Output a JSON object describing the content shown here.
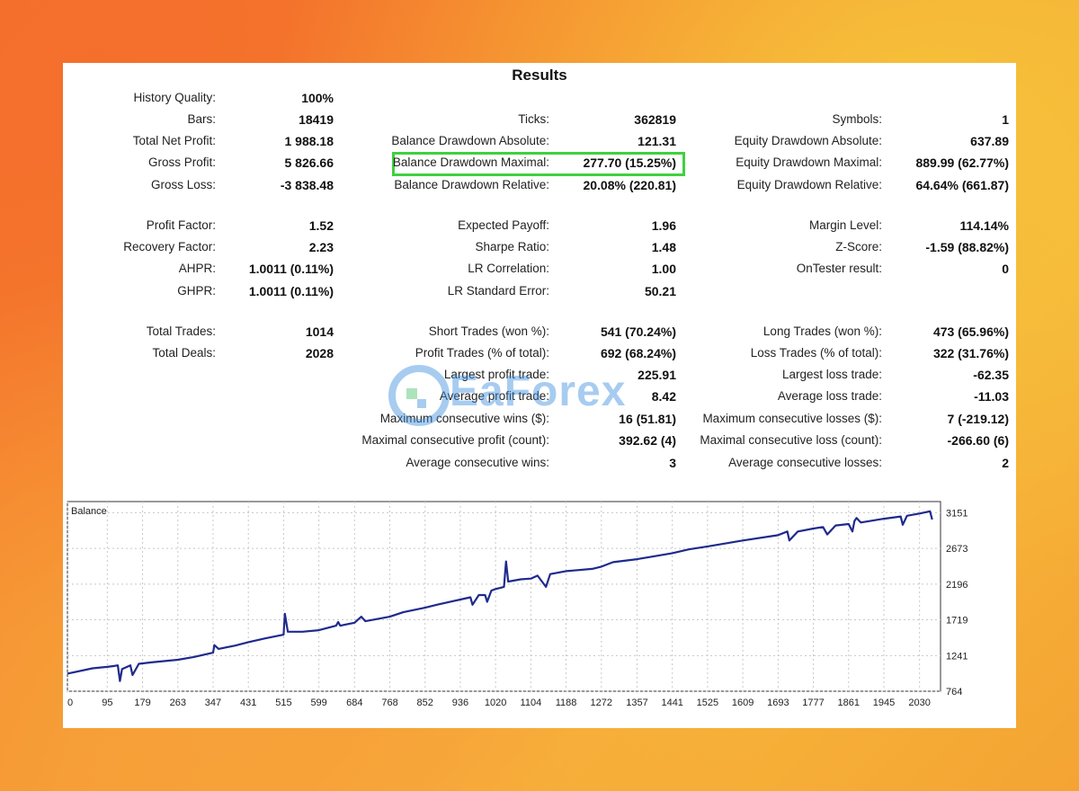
{
  "title": "Results",
  "watermark": "EaForex",
  "col1": [
    {
      "label": "History Quality:",
      "value": "100%"
    },
    {
      "label": "Bars:",
      "value": "18419"
    },
    {
      "label": "Total Net Profit:",
      "value": "1 988.18"
    },
    {
      "label": "Gross Profit:",
      "value": "5 826.66"
    },
    {
      "label": "Gross Loss:",
      "value": "-3 838.48"
    },
    {
      "label": "Profit Factor:",
      "value": "1.52"
    },
    {
      "label": "Recovery Factor:",
      "value": "2.23"
    },
    {
      "label": "AHPR:",
      "value": "1.0011 (0.11%)"
    },
    {
      "label": "GHPR:",
      "value": "1.0011 (0.11%)"
    },
    {
      "label": "Total Trades:",
      "value": "1014"
    },
    {
      "label": "Total Deals:",
      "value": "2028"
    }
  ],
  "col2": [
    {
      "label": "Ticks:",
      "value": "362819"
    },
    {
      "label": "Balance Drawdown Absolute:",
      "value": "121.31"
    },
    {
      "label": "Balance Drawdown Maximal:",
      "value": "277.70 (15.25%)"
    },
    {
      "label": "Balance Drawdown Relative:",
      "value": "20.08% (220.81)"
    },
    {
      "label": "Expected Payoff:",
      "value": "1.96"
    },
    {
      "label": "Sharpe Ratio:",
      "value": "1.48"
    },
    {
      "label": "LR Correlation:",
      "value": "1.00"
    },
    {
      "label": "LR Standard Error:",
      "value": "50.21"
    },
    {
      "label": "Short Trades (won %):",
      "value": "541 (70.24%)"
    },
    {
      "label": "Profit Trades (% of total):",
      "value": "692 (68.24%)"
    },
    {
      "label": "Largest profit trade:",
      "value": "225.91"
    },
    {
      "label": "Average profit trade:",
      "value": "8.42"
    },
    {
      "label": "Maximum consecutive wins ($):",
      "value": "16 (51.81)"
    },
    {
      "label": "Maximal consecutive profit (count):",
      "value": "392.62 (4)"
    },
    {
      "label": "Average consecutive wins:",
      "value": "3"
    }
  ],
  "col3": [
    {
      "label": "Symbols:",
      "value": "1"
    },
    {
      "label": "Equity Drawdown Absolute:",
      "value": "637.89"
    },
    {
      "label": "Equity Drawdown Maximal:",
      "value": "889.99 (62.77%)"
    },
    {
      "label": "Equity Drawdown Relative:",
      "value": "64.64% (661.87)"
    },
    {
      "label": "Margin Level:",
      "value": "114.14%"
    },
    {
      "label": "Z-Score:",
      "value": "-1.59 (88.82%)"
    },
    {
      "label": "OnTester result:",
      "value": "0"
    },
    {
      "label": "Long Trades (won %):",
      "value": "473 (65.96%)"
    },
    {
      "label": "Loss Trades (% of total):",
      "value": "322 (31.76%)"
    },
    {
      "label": "Largest loss trade:",
      "value": "-62.35"
    },
    {
      "label": "Average loss trade:",
      "value": "-11.03"
    },
    {
      "label": "Maximum consecutive losses ($):",
      "value": "7 (-219.12)"
    },
    {
      "label": "Maximal consecutive loss (count):",
      "value": "-266.60 (6)"
    },
    {
      "label": "Average consecutive losses:",
      "value": "2"
    }
  ],
  "highlight_color": "#3fd13f",
  "chart_data": {
    "type": "line",
    "title": "Balance",
    "series": [
      {
        "color": "#1f2a8c",
        "points": [
          [
            0,
            1000
          ],
          [
            60,
            1070
          ],
          [
            95,
            1090
          ],
          [
            110,
            1100
          ],
          [
            120,
            1110
          ],
          [
            125,
            900
          ],
          [
            130,
            1060
          ],
          [
            150,
            1110
          ],
          [
            155,
            980
          ],
          [
            170,
            1130
          ],
          [
            200,
            1150
          ],
          [
            263,
            1185
          ],
          [
            300,
            1220
          ],
          [
            347,
            1280
          ],
          [
            350,
            1380
          ],
          [
            360,
            1330
          ],
          [
            400,
            1375
          ],
          [
            431,
            1420
          ],
          [
            470,
            1470
          ],
          [
            515,
            1520
          ],
          [
            518,
            1800
          ],
          [
            525,
            1560
          ],
          [
            560,
            1560
          ],
          [
            599,
            1580
          ],
          [
            640,
            1640
          ],
          [
            645,
            1690
          ],
          [
            650,
            1640
          ],
          [
            684,
            1680
          ],
          [
            700,
            1760
          ],
          [
            710,
            1700
          ],
          [
            768,
            1760
          ],
          [
            800,
            1820
          ],
          [
            852,
            1880
          ],
          [
            880,
            1920
          ],
          [
            936,
            1990
          ],
          [
            960,
            2020
          ],
          [
            965,
            1920
          ],
          [
            980,
            2050
          ],
          [
            995,
            2050
          ],
          [
            1000,
            1960
          ],
          [
            1010,
            2110
          ],
          [
            1020,
            2130
          ],
          [
            1040,
            2160
          ],
          [
            1045,
            2500
          ],
          [
            1050,
            2230
          ],
          [
            1080,
            2260
          ],
          [
            1104,
            2270
          ],
          [
            1120,
            2310
          ],
          [
            1140,
            2160
          ],
          [
            1150,
            2330
          ],
          [
            1188,
            2370
          ],
          [
            1250,
            2400
          ],
          [
            1272,
            2430
          ],
          [
            1300,
            2490
          ],
          [
            1357,
            2530
          ],
          [
            1400,
            2570
          ],
          [
            1441,
            2610
          ],
          [
            1480,
            2660
          ],
          [
            1525,
            2700
          ],
          [
            1609,
            2780
          ],
          [
            1693,
            2850
          ],
          [
            1715,
            2900
          ],
          [
            1720,
            2780
          ],
          [
            1740,
            2900
          ],
          [
            1777,
            2940
          ],
          [
            1800,
            2960
          ],
          [
            1810,
            2860
          ],
          [
            1830,
            2980
          ],
          [
            1861,
            3000
          ],
          [
            1870,
            2900
          ],
          [
            1875,
            3040
          ],
          [
            1880,
            3080
          ],
          [
            1890,
            3020
          ],
          [
            1945,
            3070
          ],
          [
            1985,
            3100
          ],
          [
            1990,
            2990
          ],
          [
            2000,
            3110
          ],
          [
            2030,
            3140
          ],
          [
            2055,
            3170
          ],
          [
            2060,
            3060
          ]
        ]
      }
    ],
    "x_ticks": [
      "0",
      "95",
      "179",
      "263",
      "347",
      "431",
      "515",
      "599",
      "684",
      "768",
      "852",
      "936",
      "1020",
      "1104",
      "1188",
      "1272",
      "1357",
      "1441",
      "1525",
      "1609",
      "1693",
      "1777",
      "1861",
      "1945",
      "2030"
    ],
    "y_ticks": [
      "764",
      "1241",
      "1719",
      "2196",
      "2673",
      "3151"
    ],
    "xlim": [
      0,
      2080
    ],
    "ylim": [
      764,
      3300
    ],
    "grid": true
  }
}
